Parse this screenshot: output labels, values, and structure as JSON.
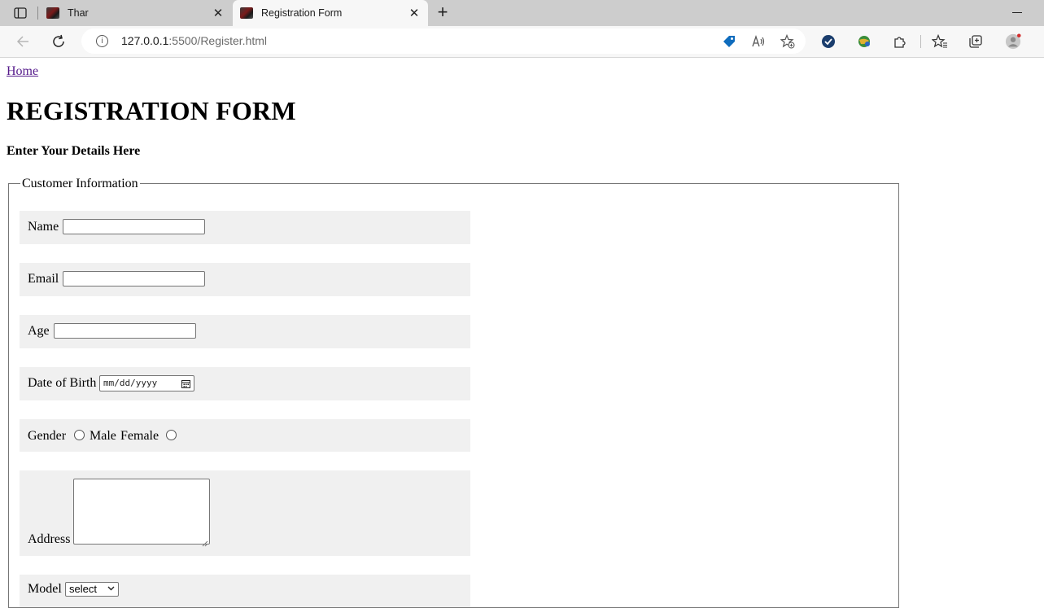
{
  "browser": {
    "tabs": [
      {
        "title": "Thar",
        "active": false
      },
      {
        "title": "Registration Form",
        "active": true
      }
    ],
    "url_host": "127.0.0.1",
    "url_path": ":5500/Register.html",
    "info_glyph": "i",
    "new_tab_glyph": "+",
    "close_glyph": "✕",
    "icons": [
      "tab-actions-icon",
      "back-icon",
      "refresh-icon",
      "site-info-icon",
      "shopping-tag-icon",
      "read-aloud-icon",
      "add-favorite-icon",
      "extension-check-icon",
      "extension-globe-icon",
      "extensions-icon",
      "favorites-icon",
      "collections-icon",
      "profile-icon"
    ],
    "accent_color": "#0f6cbd"
  },
  "page": {
    "home_link": "Home",
    "title": "REGISTRATION FORM",
    "subtitle": "Enter Your Details Here",
    "fieldset_legend": "Customer Information",
    "fields": {
      "name_label": "Name",
      "email_label": "Email",
      "age_label": "Age",
      "dob_label": "Date of Birth",
      "dob_placeholder": "mm/dd/yyyy",
      "gender_label": "Gender",
      "gender_male": "Male",
      "gender_female": "Female",
      "address_label": "Address",
      "model_label": "Model",
      "model_selected": "select"
    }
  }
}
